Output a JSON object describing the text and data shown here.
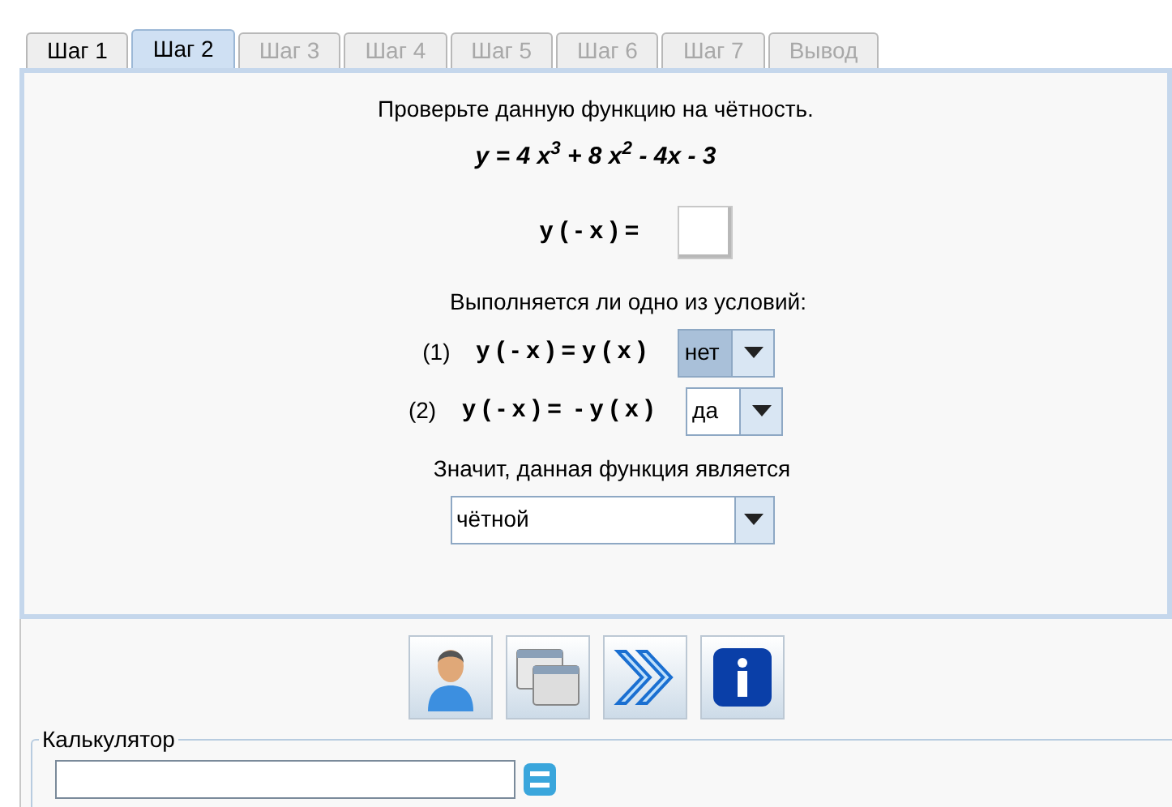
{
  "tabs": [
    {
      "label": "Шаг 1",
      "selected": false,
      "disabled": false
    },
    {
      "label": "Шаг 2",
      "selected": true,
      "disabled": false
    },
    {
      "label": "Шаг 3",
      "selected": false,
      "disabled": true
    },
    {
      "label": "Шаг 4",
      "selected": false,
      "disabled": true
    },
    {
      "label": "Шаг 5",
      "selected": false,
      "disabled": true
    },
    {
      "label": "Шаг 6",
      "selected": false,
      "disabled": true
    },
    {
      "label": "Шаг 7",
      "selected": false,
      "disabled": true
    },
    {
      "label": "Вывод",
      "selected": false,
      "disabled": true
    }
  ],
  "task": {
    "instruction": "Проверьте данную функцию на чётность.",
    "formula": "y = 4 x$^{3}$ + 8 x$^{2}$ - 4x - 3"
  },
  "substitution": {
    "expression": "y ( - x ) ="
  },
  "question": "Выполняется ли одно из условий:",
  "conditions": [
    {
      "number": "(1)",
      "expression": "y ( - x ) = y ( x )",
      "value": "нет",
      "focused": true
    },
    {
      "number": "(2)",
      "expression": "y ( - x ) =  - y ( x )",
      "value": "да",
      "focused": false
    }
  ],
  "conclusion": {
    "text": "Значит, данная функция является",
    "value": "чётной"
  },
  "calculator": {
    "legend": "Калькулятор"
  }
}
